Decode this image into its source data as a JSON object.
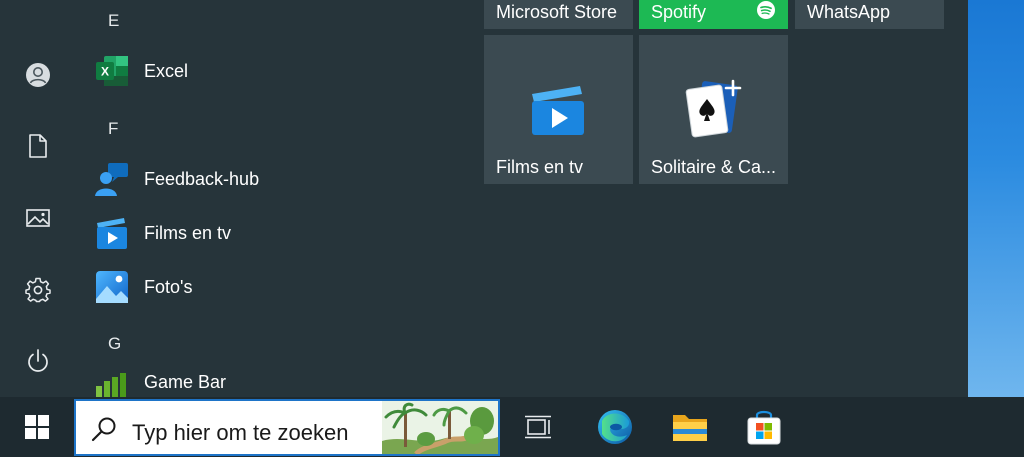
{
  "colors": {
    "accent": "#1e74c8",
    "menu_bg": "#26343a",
    "tile_bg": "#3b4a51",
    "spotify": "#1db954"
  },
  "rail": {
    "items": [
      {
        "name": "user-account",
        "icon": "person-circle-icon"
      },
      {
        "name": "documents",
        "icon": "document-icon"
      },
      {
        "name": "pictures",
        "icon": "picture-icon"
      },
      {
        "name": "settings",
        "icon": "gear-icon"
      },
      {
        "name": "power",
        "icon": "power-icon"
      }
    ]
  },
  "app_list": {
    "letters": {
      "e": "E",
      "f": "F",
      "g": "G"
    },
    "apps": {
      "excel": "Excel",
      "feedback": "Feedback-hub",
      "films": "Films en tv",
      "fotos": "Foto's",
      "gamebar": "Game Bar"
    }
  },
  "tiles": {
    "store": "Microsoft Store",
    "spotify": "Spotify",
    "whatsapp": "WhatsApp",
    "films": "Films en tv",
    "solitaire": "Solitaire & Ca..."
  },
  "taskbar": {
    "search_placeholder": "Typ hier om te zoeken",
    "pinned": [
      "task-view-icon",
      "edge-icon",
      "file-explorer-icon",
      "microsoft-store-icon"
    ]
  }
}
